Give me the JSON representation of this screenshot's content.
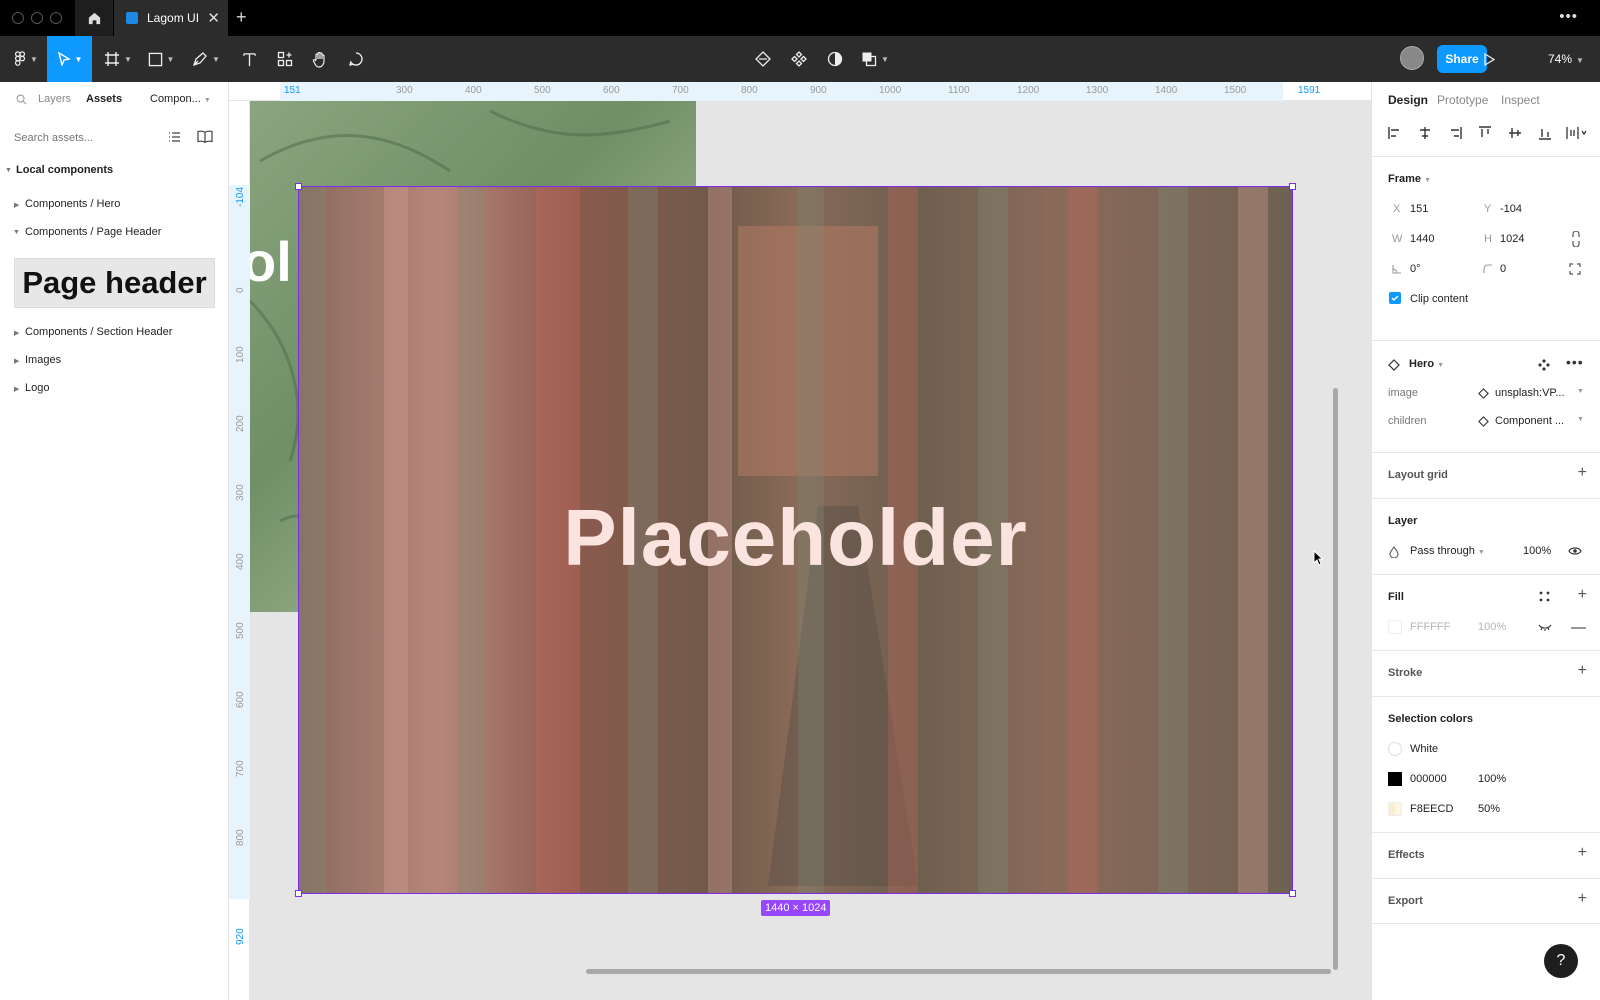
{
  "titlebar": {
    "doc_tab": "Lagom UI",
    "close": "✕",
    "new_tab": "+",
    "more": "•••"
  },
  "toolbar": {
    "share": "Share",
    "zoom": "74%"
  },
  "left_panel": {
    "tabs": {
      "layers": "Layers",
      "assets": "Assets",
      "library": "Compon..."
    },
    "search_placeholder": "Search assets...",
    "section": "Local components",
    "items": [
      "Components / Hero",
      "Components / Page Header",
      "Components / Section Header",
      "Images",
      "Logo"
    ],
    "thumb_text": "Page header"
  },
  "canvas": {
    "ruler_x": [
      "151",
      "300",
      "400",
      "500",
      "600",
      "700",
      "800",
      "900",
      "1000",
      "1100",
      "1200",
      "1300",
      "1400",
      "1500",
      "1591"
    ],
    "ruler_y": [
      "-104",
      "0",
      "100",
      "200",
      "300",
      "400",
      "500",
      "600",
      "700",
      "800",
      "920"
    ],
    "placeholder": "Placeholder",
    "partial_text": "ol",
    "size_badge": "1440 × 1024"
  },
  "right_panel": {
    "tabs": {
      "design": "Design",
      "prototype": "Prototype",
      "inspect": "Inspect"
    },
    "frame": {
      "title": "Frame",
      "x_label": "X",
      "x": "151",
      "y_label": "Y",
      "y": "-104",
      "w_label": "W",
      "w": "1440",
      "h_label": "H",
      "h": "1024",
      "rotation": "0°",
      "radius": "0",
      "clip": "Clip content"
    },
    "component": {
      "name": "Hero",
      "prop1_label": "image",
      "prop1_value": "unsplash:VP...",
      "prop2_label": "children",
      "prop2_value": "Component ..."
    },
    "layout_grid": "Layout grid",
    "layer": {
      "title": "Layer",
      "blend": "Pass through",
      "opacity": "100%"
    },
    "fill": {
      "title": "Fill",
      "hex": "FFFFFF",
      "opacity": "100%"
    },
    "stroke": "Stroke",
    "selection_colors": {
      "title": "Selection colors",
      "c1": "White",
      "c2_hex": "000000",
      "c2_op": "100%",
      "c3_hex": "F8EECD",
      "c3_op": "50%"
    },
    "effects": "Effects",
    "export": "Export",
    "help": "?"
  },
  "colors": {
    "accent": "#0d99ff",
    "selection": "#7b2cf0",
    "toolbar": "#2c2c2c"
  }
}
